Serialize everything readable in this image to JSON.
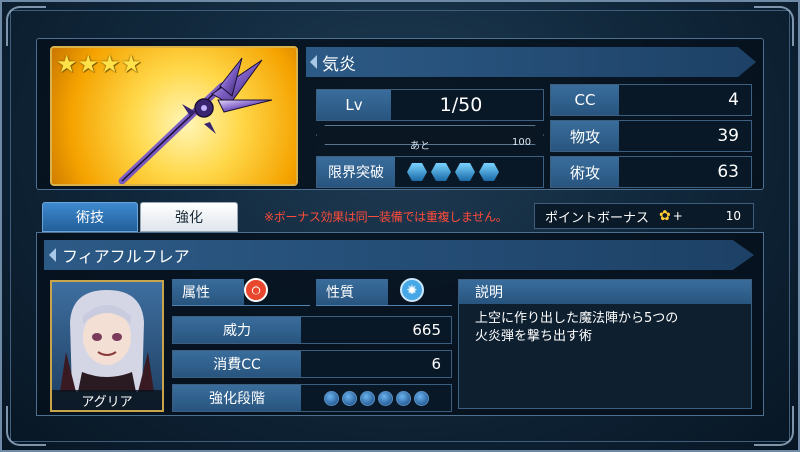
{
  "weapon": {
    "name": "気炎",
    "rarity_stars": "★★★★",
    "icon": "trident-spear-icon",
    "level_label": "Lv",
    "level_value": "1/50",
    "exp_remaining_label": "あと",
    "exp_remaining_value": "100",
    "limit_break_label": "限界突破",
    "limit_break_hexes": 4,
    "stats": {
      "cc_label": "CC",
      "cc_value": "4",
      "phys_label": "物攻",
      "phys_value": "39",
      "magic_label": "術攻",
      "magic_value": "63"
    }
  },
  "tabs": {
    "skill": "術技",
    "enhance": "強化"
  },
  "notice": "※ボーナス効果は同一装備では重複しません。",
  "bonus": {
    "label": "ポイントボーナス",
    "plus": "+",
    "value": "10",
    "icon": "bonus-character-icon"
  },
  "skill": {
    "name": "フィアフルフレア",
    "character_name": "アグリア",
    "attribute_label": "属性",
    "attribute_icon": "fire-element-icon",
    "property_label": "性質",
    "property_icon": "water-crystal-icon",
    "power_label": "威力",
    "power_value": "665",
    "cost_label": "消費CC",
    "cost_value": "6",
    "stage_label": "強化段階",
    "stage_dots": 6,
    "description_label": "説明",
    "description": "上空に作り出した魔法陣から5つの\n火炎弾を撃ち出す術"
  },
  "colors": {
    "panel_blue": "#2c5a86",
    "notice_red": "#ff4b3a",
    "gold_card": "#f5a300"
  }
}
